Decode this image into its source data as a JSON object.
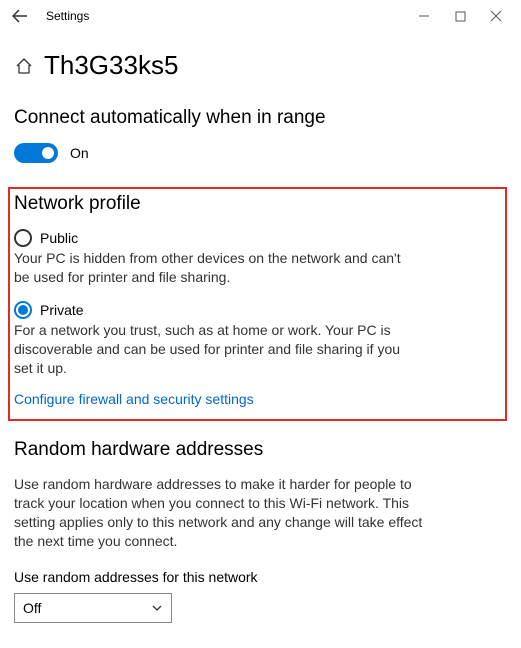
{
  "titlebar": {
    "title": "Settings"
  },
  "header": {
    "network_name": "Th3G33ks5"
  },
  "connect_auto": {
    "title": "Connect automatically when in range",
    "toggle_label": "On"
  },
  "network_profile": {
    "title": "Network profile",
    "public_label": "Public",
    "public_desc": "Your PC is hidden from other devices on the network and can't be used for printer and file sharing.",
    "private_label": "Private",
    "private_desc": "For a network you trust, such as at home or work. Your PC is discoverable and can be used for printer and file sharing if you set it up.",
    "link": "Configure firewall and security settings"
  },
  "random_hw": {
    "title": "Random hardware addresses",
    "desc": "Use random hardware addresses to make it harder for people to track your location when you connect to this Wi-Fi network. This setting applies only to this network and any change will take effect the next time you connect.",
    "select_label": "Use random addresses for this network",
    "select_value": "Off"
  }
}
